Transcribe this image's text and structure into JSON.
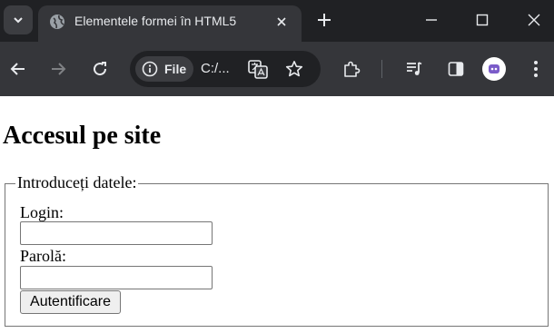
{
  "browser": {
    "tab_title": "Elementele formei în HTML5",
    "site_info_label": "File",
    "url": "C:/..."
  },
  "page": {
    "heading": "Accesul pe site",
    "form": {
      "legend": "Introduceți datele:",
      "login_label": "Login:",
      "login_value": "",
      "password_label": "Parolă:",
      "password_value": "",
      "submit_label": "Autentificare"
    }
  },
  "colors": {
    "tab_strip": "#202124",
    "toolbar": "#35363a",
    "profile_accent": "#7b5cc9"
  }
}
